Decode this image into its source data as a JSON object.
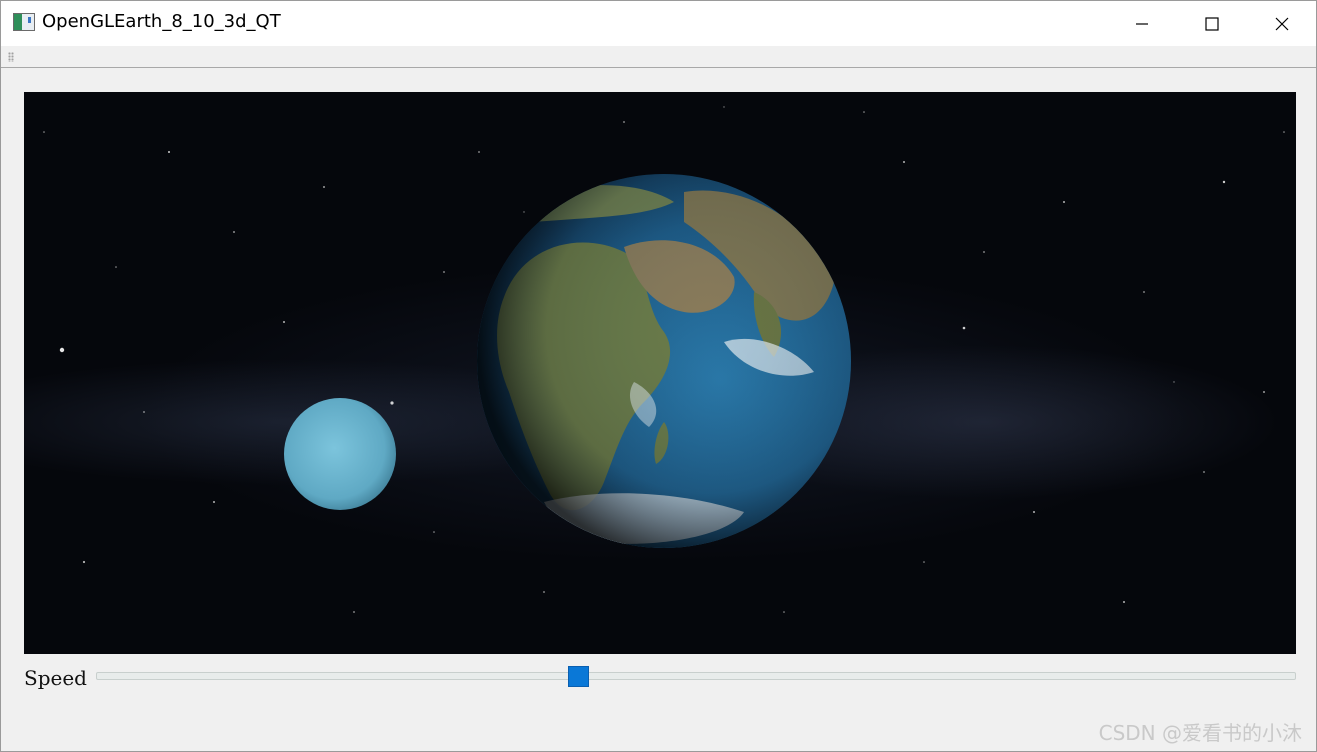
{
  "window": {
    "title": "OpenGLEarth_8_10_3d_QT"
  },
  "controls": {
    "speed_label": "Speed",
    "speed_value": 0.4
  },
  "watermark": "CSDN @爱看书的小沐",
  "icons": [
    "app-icon",
    "minimize-icon",
    "maximize-icon",
    "close-icon",
    "toolbar-grip-icon"
  ],
  "colors": {
    "slider_handle": "#0a78d7",
    "space_background": "#05070c",
    "ocean": "#1f5f8a",
    "planet_cyan": "#6ab4cf"
  }
}
